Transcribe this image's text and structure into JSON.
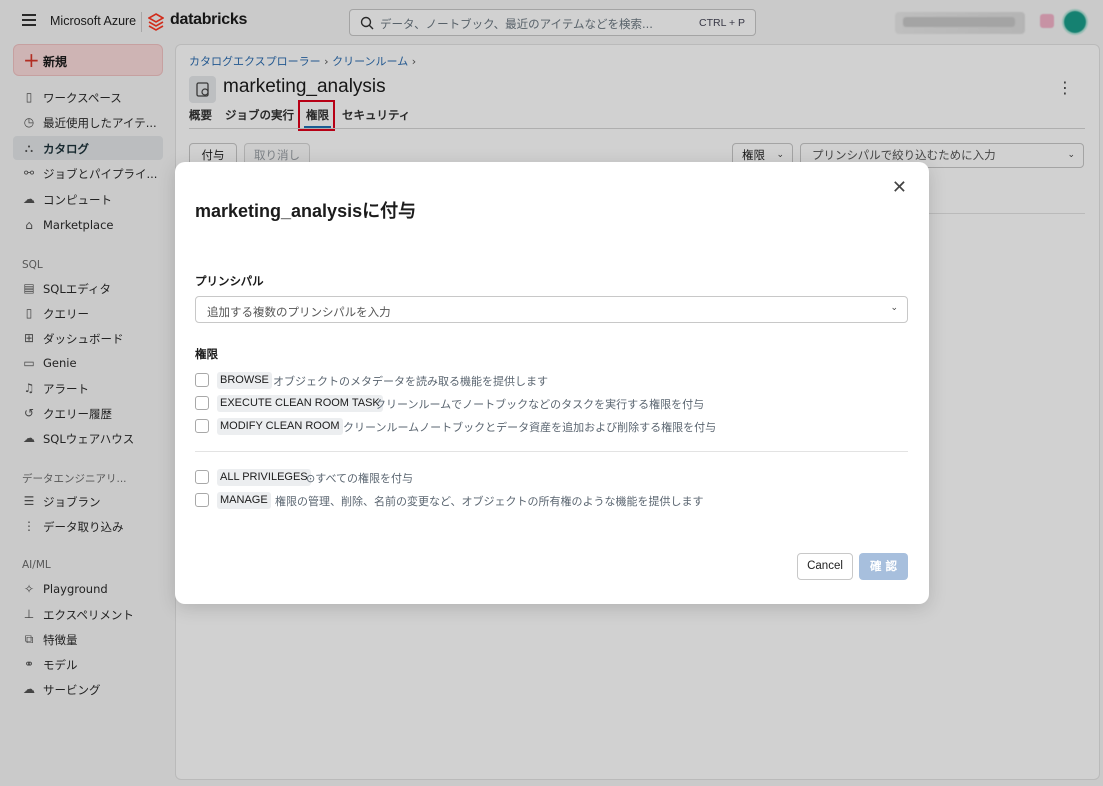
{
  "topbar": {
    "brand": "Microsoft Azure",
    "product": "databricks",
    "search_placeholder": "データ、ノートブック、最近のアイテムなどを検索...",
    "search_shortcut": "CTRL + P"
  },
  "sidebar": {
    "new_label": "新規",
    "items": [
      {
        "label": "ワークスペース",
        "icon": "folder-icon"
      },
      {
        "label": "最近使用したアイテ...",
        "icon": "clock-icon"
      },
      {
        "label": "カタログ",
        "icon": "catalog-icon",
        "active": true
      },
      {
        "label": "ジョブとパイプライ...",
        "icon": "workflow-icon"
      },
      {
        "label": "コンピュート",
        "icon": "cloud-icon"
      },
      {
        "label": "Marketplace",
        "icon": "store-icon"
      }
    ],
    "sql_section": "SQL",
    "sql_items": [
      {
        "label": "SQLエディタ",
        "icon": "editor-icon"
      },
      {
        "label": "クエリー",
        "icon": "query-icon"
      },
      {
        "label": "ダッシュボード",
        "icon": "dashboard-icon"
      },
      {
        "label": "Genie",
        "icon": "genie-icon"
      },
      {
        "label": "アラート",
        "icon": "bell-icon"
      },
      {
        "label": "クエリー履歴",
        "icon": "history-icon"
      },
      {
        "label": "SQLウェアハウス",
        "icon": "warehouse-icon"
      }
    ],
    "de_section": "データエンジニアリ...",
    "de_items": [
      {
        "label": "ジョブラン",
        "icon": "list-icon"
      },
      {
        "label": "データ取り込み",
        "icon": "ingest-icon"
      }
    ],
    "ml_section": "AI/ML",
    "ml_items": [
      {
        "label": "Playground",
        "icon": "sparkle-icon"
      },
      {
        "label": "エクスペリメント",
        "icon": "flask-icon"
      },
      {
        "label": "特徴量",
        "icon": "feature-icon"
      },
      {
        "label": "モデル",
        "icon": "model-icon"
      },
      {
        "label": "サービング",
        "icon": "serving-icon"
      }
    ]
  },
  "main": {
    "breadcrumb": [
      "カタログエクスプローラー",
      "クリーンルーム"
    ],
    "title": "marketing_analysis",
    "tabs": [
      "概要",
      "ジョブの実行",
      "権限",
      "セキュリティ"
    ],
    "active_tab": "権限",
    "grant_button": "付与",
    "revoke_button": "取り消し",
    "perm_filter": "権限",
    "principal_filter_placeholder": "プリンシパルで絞り込むために入力"
  },
  "modal": {
    "title": "marketing_analysisに付与",
    "principal_label": "プリンシパル",
    "principal_placeholder": "追加する複数のプリンシパルを入力",
    "privileges_label": "権限",
    "privileges": [
      {
        "name": "BROWSE",
        "desc": "オブジェクトのメタデータを読み取る機能を提供します"
      },
      {
        "name": "EXECUTE CLEAN ROOM TASK",
        "desc": "クリーンルームでノートブックなどのタスクを実行する権限を付与"
      },
      {
        "name": "MODIFY CLEAN ROOM",
        "desc": "クリーンルームノートブックとデータ資産を追加および削除する権限を付与"
      }
    ],
    "extra_privileges": [
      {
        "name": "ALL PRIVILEGES",
        "desc": "すべての権限を付与"
      },
      {
        "name": "MANAGE",
        "desc": "権限の管理、削除、名前の変更など、オブジェクトの所有権のような機能を提供します"
      }
    ],
    "cancel": "Cancel",
    "confirm": "確 認"
  },
  "colors": {
    "accent": "#2272b4",
    "new_button_bg": "#fcdcdc",
    "confirm_disabled": "#a7bfdd",
    "highlight": "#e0001a"
  }
}
